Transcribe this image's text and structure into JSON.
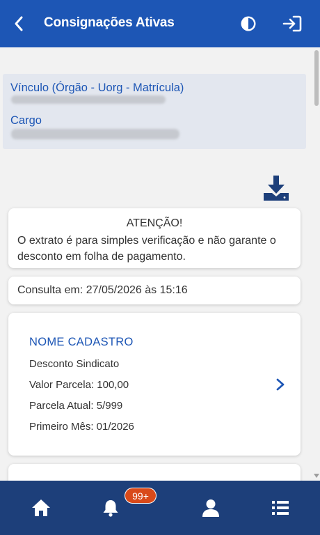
{
  "header": {
    "title": "Consignações Ativas",
    "icons": [
      "chevron-left-icon",
      "contrast-icon",
      "logout-icon"
    ]
  },
  "vinculo": {
    "label": "Vínculo (Órgão - Uorg - Matrícula)",
    "cargo_label": "Cargo"
  },
  "download_icon": "download-icon",
  "attention": {
    "title": "ATENÇÃO!",
    "text": "O extrato é para simples verificação e não garante o desconto em folha de pagamento."
  },
  "consulta": {
    "text": "Consulta em: 27/05/2026 às 15:16"
  },
  "consignacao": {
    "title": "NOME CADASTRO",
    "descricao": "Desconto Sindicato",
    "valor": "Valor Parcela: 100,00",
    "parcela": "Parcela Atual: 5/999",
    "primeiro_mes": "Primeiro Mês: 01/2026"
  },
  "bottom_nav": {
    "items": [
      "home-icon",
      "bell-icon",
      "user-icon",
      "list-icon"
    ],
    "notification_badge": "99+"
  },
  "colors": {
    "header": "#1d56b5",
    "bottom_nav": "#1d3f7a",
    "badge": "#d94a1a",
    "accent_text": "#1d56b5"
  }
}
